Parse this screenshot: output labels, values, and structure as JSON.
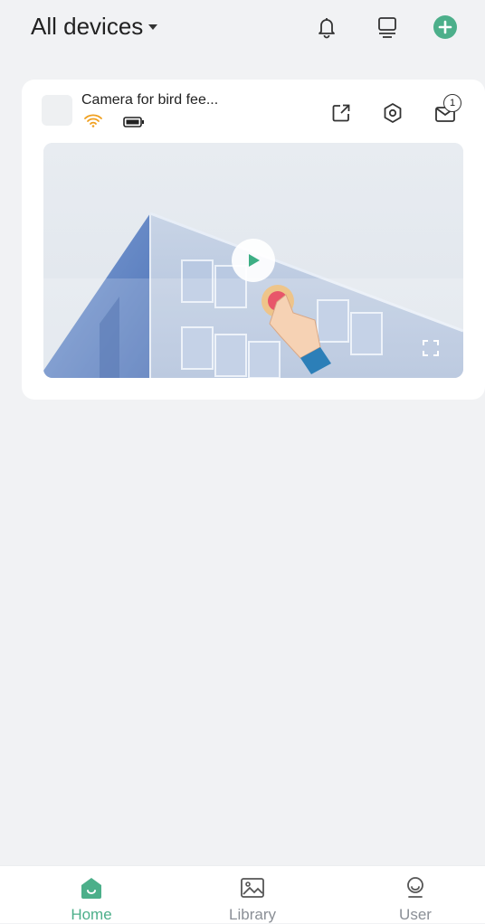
{
  "header": {
    "title": "All devices",
    "icons": [
      "bell-icon",
      "devices-icon",
      "add-icon"
    ],
    "accent_color": "#4caf8a"
  },
  "device_card": {
    "name": "Camera for bird fee...",
    "status_icons": [
      "wifi-icon",
      "battery-icon"
    ],
    "actions": [
      "share-icon",
      "settings-icon",
      "messages-icon"
    ],
    "message_count": "1",
    "preview": {
      "controls": [
        "play-icon",
        "fullscreen-icon"
      ]
    }
  },
  "bottom_nav": {
    "items": [
      {
        "label": "Home",
        "icon": "home-icon",
        "active": true
      },
      {
        "label": "Library",
        "icon": "library-icon",
        "active": false
      },
      {
        "label": "User",
        "icon": "user-icon",
        "active": false
      }
    ]
  }
}
